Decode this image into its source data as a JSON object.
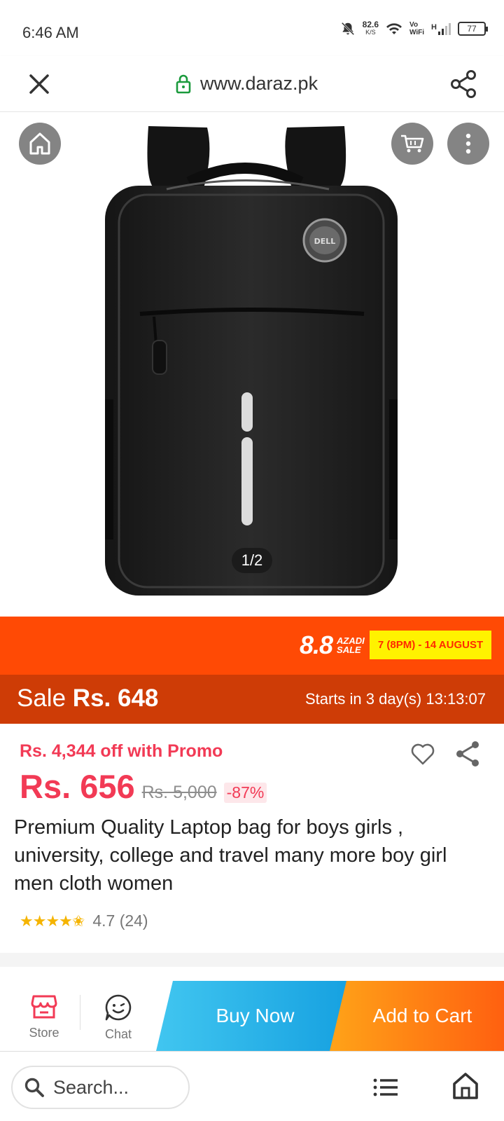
{
  "status_bar": {
    "time": "6:46 AM",
    "net_speed": "82.6",
    "net_unit": "K/S",
    "volte_top": "Vo",
    "volte_bottom": "WiFi",
    "signal_type": "H",
    "battery": "77"
  },
  "browser": {
    "url": "www.daraz.pk"
  },
  "gallery": {
    "counter": "1/2",
    "logo_text": "DELL"
  },
  "campaign": {
    "big": "8.8",
    "tag_line1": "AZADI",
    "tag_line2": "SALE",
    "dates": "7 (8PM) - 14 AUGUST"
  },
  "flash_sale": {
    "label": "Sale",
    "price": "Rs. 648",
    "countdown": "Starts in 3 day(s) 13:13:07"
  },
  "product": {
    "promo_text": "Rs. 4,344 off with Promo",
    "price": "Rs. 656",
    "original_price": "Rs. 5,000",
    "discount": "-87%",
    "title": "Premium Quality Laptop bag for boys girls , university, college and travel many more boy girl men cloth women",
    "stars": "★★★★✬",
    "rating_text": "4.7 (24)"
  },
  "actions": {
    "store_label": "Store",
    "chat_label": "Chat",
    "buy_now": "Buy Now",
    "add_to_cart": "Add to Cart"
  },
  "bottom_bar": {
    "search_placeholder": "Search..."
  },
  "colors": {
    "brand_orange": "#ff4a05",
    "sale_dark": "#ce3c06",
    "price_red": "#f23a55",
    "buy_blue": "#15a0e0",
    "cart_orange": "#ff6010"
  }
}
